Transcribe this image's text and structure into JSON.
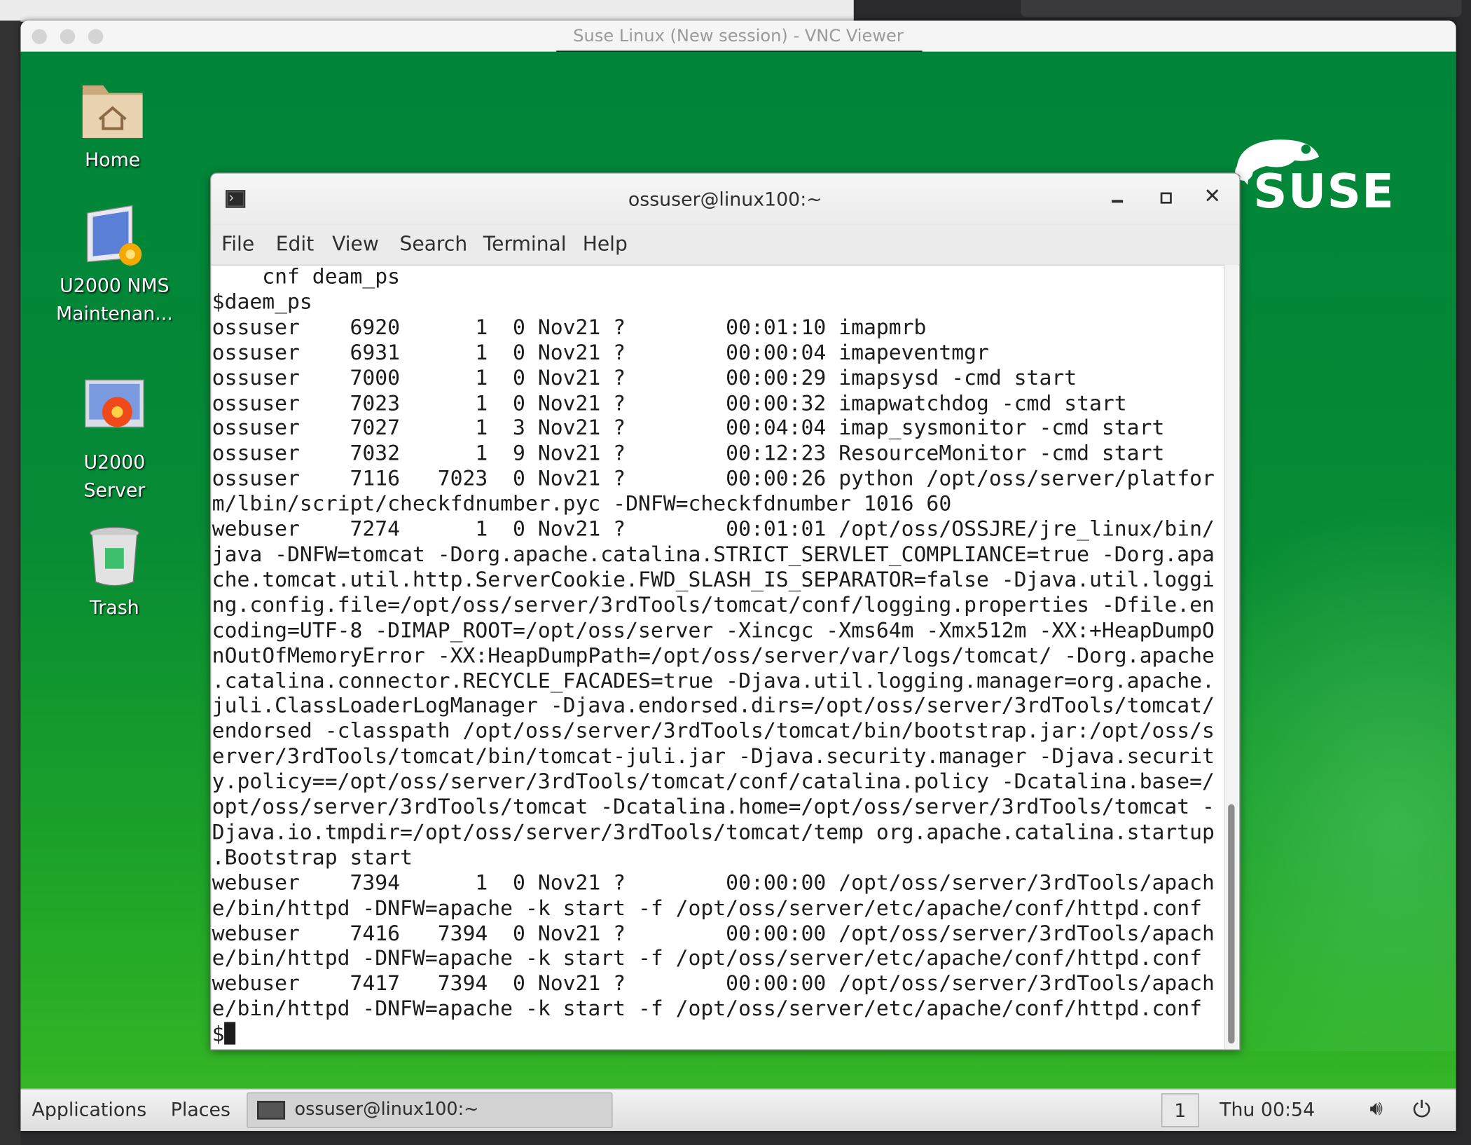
{
  "vnc": {
    "title": "Suse Linux (New session) - VNC Viewer"
  },
  "desktop": {
    "icons": [
      {
        "label": "Home",
        "icon": "home-folder-icon"
      },
      {
        "label": "U2000 NMS Maintenan...",
        "icon": "monitor-gear-icon"
      },
      {
        "label": "U2000 Server",
        "icon": "server-gear-icon"
      },
      {
        "label": "Trash",
        "icon": "trash-icon"
      }
    ],
    "logo": "SUSE"
  },
  "terminal": {
    "title": "ossuser@linux100:~",
    "menu": [
      "File",
      "Edit",
      "View",
      "Search",
      "Terminal",
      "Help"
    ],
    "lines": [
      "    cnf deam_ps",
      "$daem_ps",
      "ossuser    6920      1  0 Nov21 ?        00:01:10 imapmrb",
      "ossuser    6931      1  0 Nov21 ?        00:00:04 imapeventmgr",
      "ossuser    7000      1  0 Nov21 ?        00:00:29 imapsysd -cmd start",
      "ossuser    7023      1  0 Nov21 ?        00:00:32 imapwatchdog -cmd start",
      "ossuser    7027      1  3 Nov21 ?        00:04:04 imap_sysmonitor -cmd start",
      "ossuser    7032      1  9 Nov21 ?        00:12:23 ResourceMonitor -cmd start",
      "ossuser    7116   7023  0 Nov21 ?        00:00:26 python /opt/oss/server/platfor",
      "m/lbin/script/checkfdnumber.pyc -DNFW=checkfdnumber 1016 60",
      "webuser    7274      1  0 Nov21 ?        00:01:01 /opt/oss/OSSJRE/jre_linux/bin/",
      "java -DNFW=tomcat -Dorg.apache.catalina.STRICT_SERVLET_COMPLIANCE=true -Dorg.apa",
      "che.tomcat.util.http.ServerCookie.FWD_SLASH_IS_SEPARATOR=false -Djava.util.loggi",
      "ng.config.file=/opt/oss/server/3rdTools/tomcat/conf/logging.properties -Dfile.en",
      "coding=UTF-8 -DIMAP_ROOT=/opt/oss/server -Xincgc -Xms64m -Xmx512m -XX:+HeapDumpO",
      "nOutOfMemoryError -XX:HeapDumpPath=/opt/oss/server/var/logs/tomcat/ -Dorg.apache",
      ".catalina.connector.RECYCLE_FACADES=true -Djava.util.logging.manager=org.apache.",
      "juli.ClassLoaderLogManager -Djava.endorsed.dirs=/opt/oss/server/3rdTools/tomcat/",
      "endorsed -classpath /opt/oss/server/3rdTools/tomcat/bin/bootstrap.jar:/opt/oss/s",
      "erver/3rdTools/tomcat/bin/tomcat-juli.jar -Djava.security.manager -Djava.securit",
      "y.policy==/opt/oss/server/3rdTools/tomcat/conf/catalina.policy -Dcatalina.base=/",
      "opt/oss/server/3rdTools/tomcat -Dcatalina.home=/opt/oss/server/3rdTools/tomcat -",
      "Djava.io.tmpdir=/opt/oss/server/3rdTools/tomcat/temp org.apache.catalina.startup",
      ".Bootstrap start",
      "webuser    7394      1  0 Nov21 ?        00:00:00 /opt/oss/server/3rdTools/apach",
      "e/bin/httpd -DNFW=apache -k start -f /opt/oss/server/etc/apache/conf/httpd.conf",
      "webuser    7416   7394  0 Nov21 ?        00:00:00 /opt/oss/server/3rdTools/apach",
      "e/bin/httpd -DNFW=apache -k start -f /opt/oss/server/etc/apache/conf/httpd.conf",
      "webuser    7417   7394  0 Nov21 ?        00:00:00 /opt/oss/server/3rdTools/apach",
      "e/bin/httpd -DNFW=apache -k start -f /opt/oss/server/etc/apache/conf/httpd.conf"
    ],
    "prompt": "$"
  },
  "taskbar": {
    "applications": "Applications",
    "places": "Places",
    "window_button": "ossuser@linux100:~",
    "workspace": "1",
    "clock": "Thu 00:54"
  },
  "colors": {
    "desktop_green": "#00843a",
    "suse_logo": "#ffffff"
  }
}
